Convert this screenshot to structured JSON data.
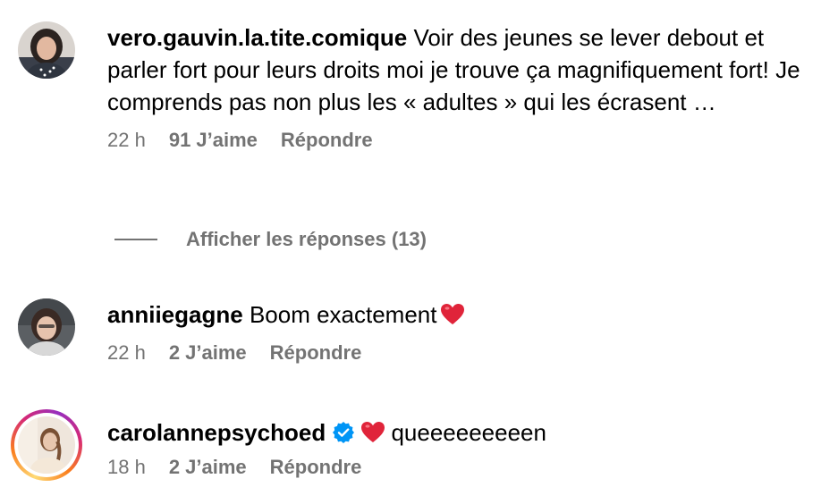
{
  "comments": [
    {
      "username": "vero.gauvin.la.tite.comique",
      "text": "Voir des jeunes se lever debout et parler fort pour leurs droits moi je trouve ça magnifiquement fort! Je comprends pas non plus les « adultes » qui les écrasent …",
      "time": "22 h",
      "likes": "91 J’aime",
      "reply": "Répondre",
      "avatar_icon": "avatar-photo"
    },
    {
      "username": "anniiegagne",
      "text": "Boom exactement",
      "emoji": "red-heart-icon",
      "time": "22 h",
      "likes": "2 J’aime",
      "reply": "Répondre",
      "avatar_icon": "avatar-photo"
    },
    {
      "username": "carolannepsychoed",
      "verified": true,
      "emoji": "red-heart-icon",
      "text": "queeeeeeeeen",
      "time": "18 h",
      "likes": "2 J’aime",
      "reply": "Répondre",
      "avatar_icon": "avatar-photo-story-ring"
    }
  ],
  "view_replies": {
    "label": "Afficher les réponses (13)"
  },
  "colors": {
    "text": "#000000",
    "meta": "#737373",
    "verified": "#0095f6",
    "heart": "#ed4956"
  }
}
